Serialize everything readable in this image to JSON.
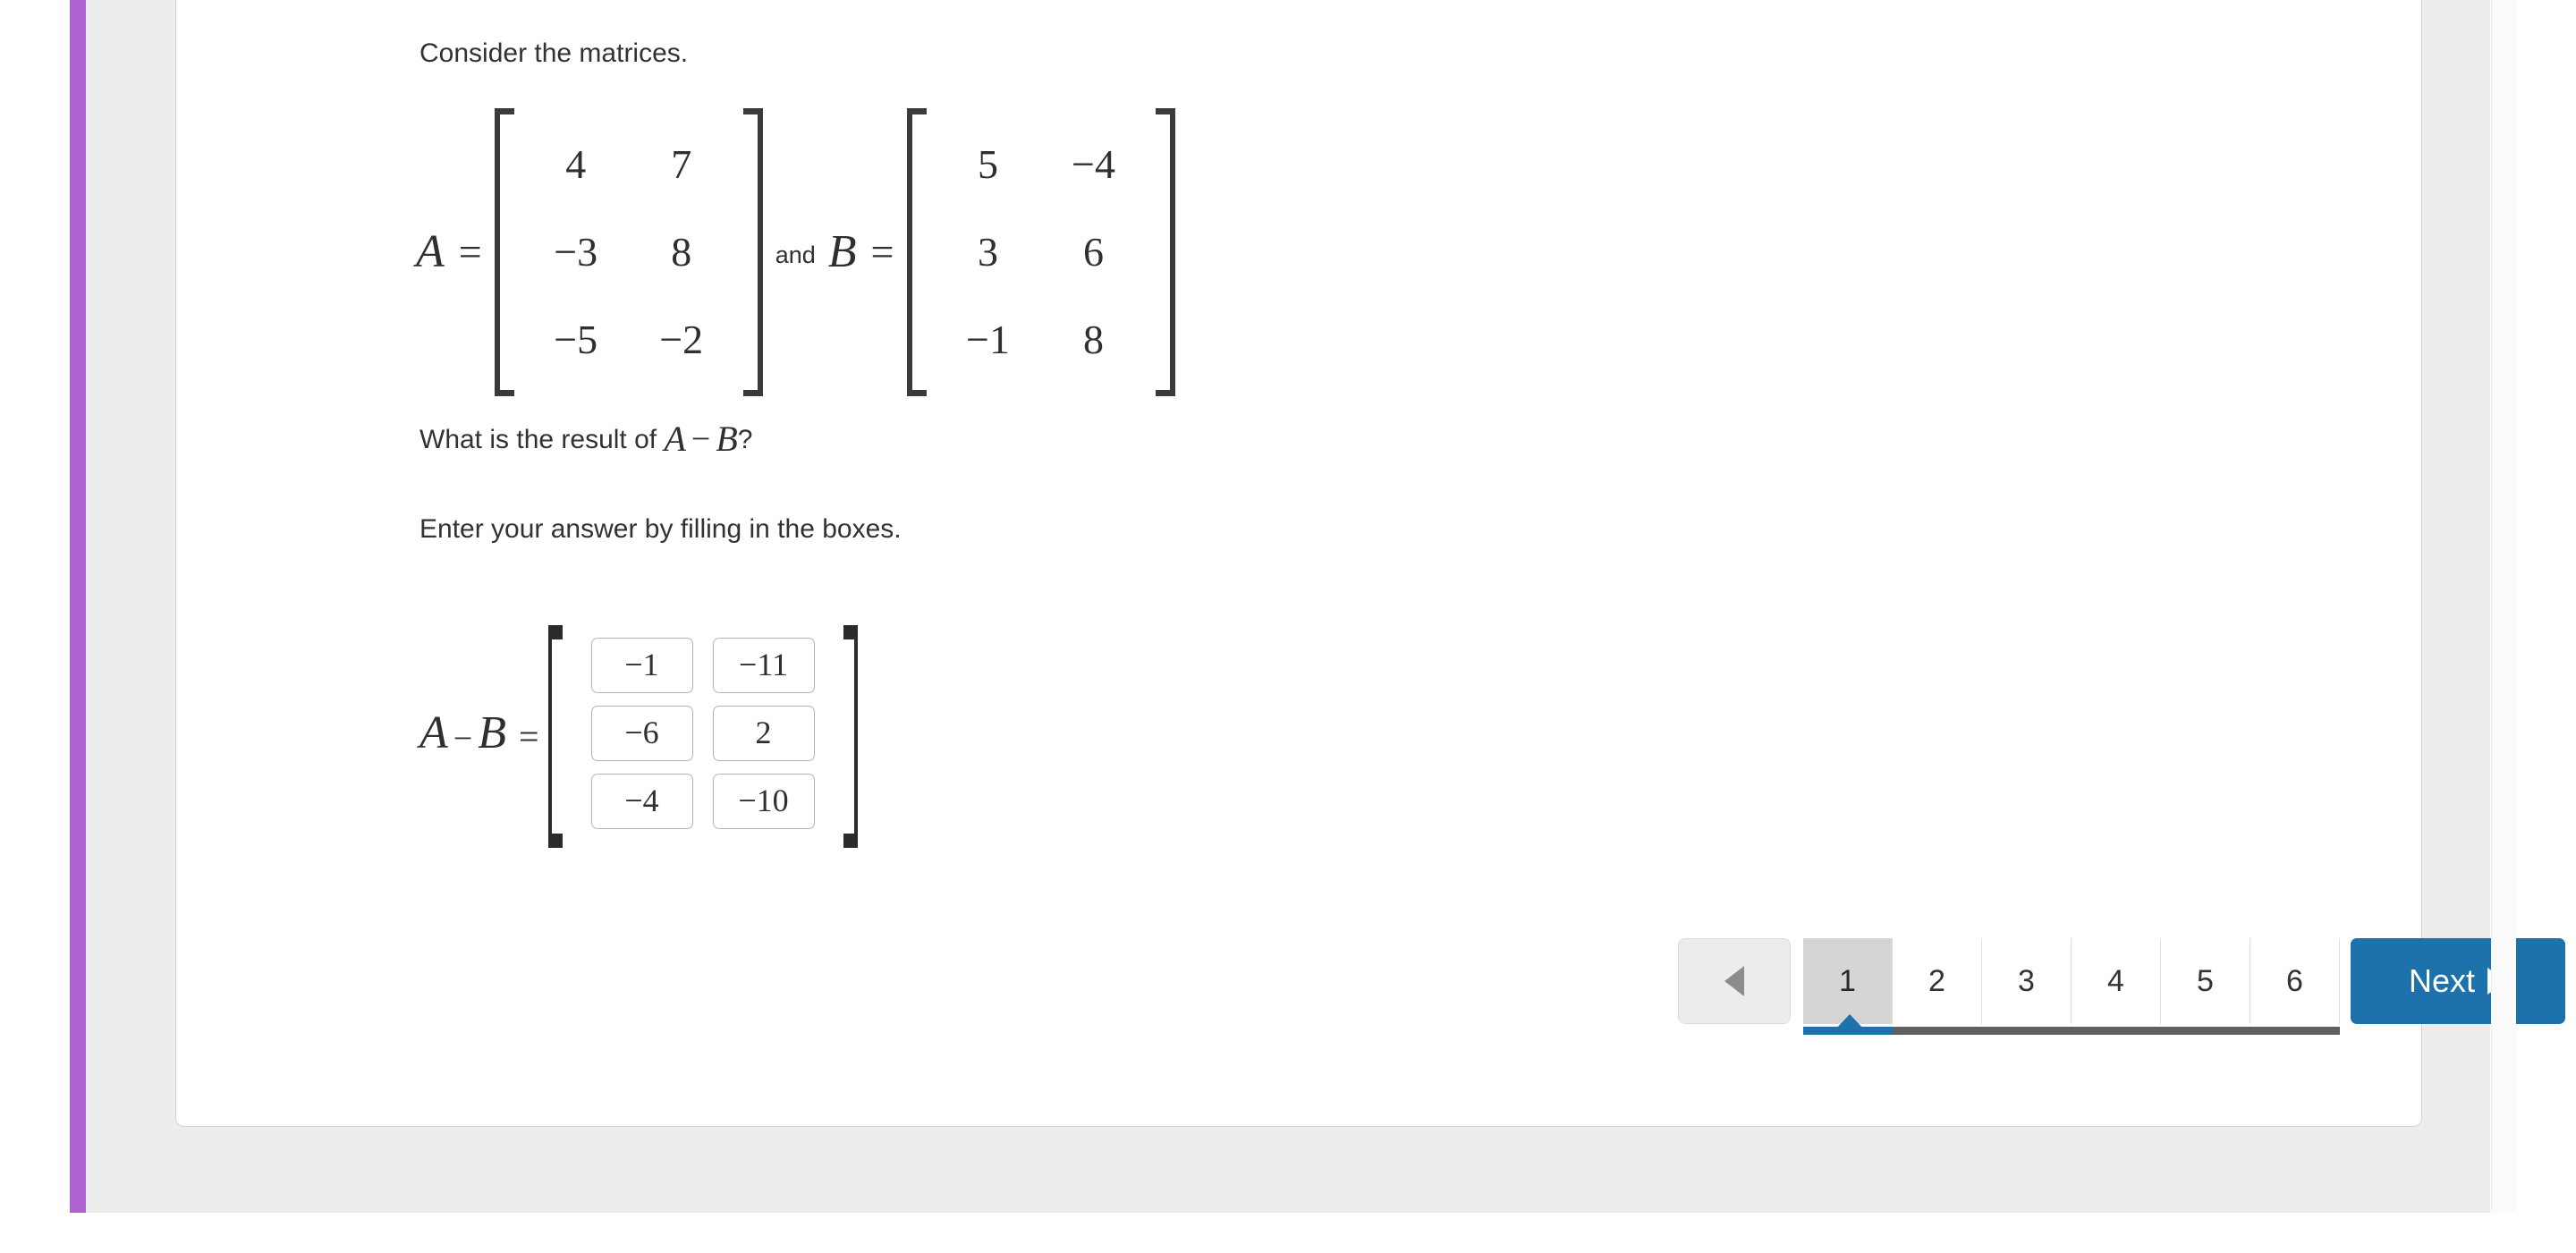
{
  "colors": {
    "rail_purple": "#b163d3",
    "app_background": "#ededed",
    "card_background": "#ffffff",
    "accent_blue": "#1d72ab",
    "active_tab_gray": "#d5d5d5",
    "progress_track_gray": "#606060",
    "text": "#323232"
  },
  "problem": {
    "intro": "Consider the matrices.",
    "question_prefix": "What is the result of ",
    "question_expr_a": "A",
    "question_expr_op": "−",
    "question_expr_b": "B",
    "question_suffix": "?",
    "instruction": "Enter your answer by filling in the boxes."
  },
  "matrix_a": {
    "label": "A",
    "equals": "=",
    "rows": [
      [
        "4",
        "7"
      ],
      [
        "−3",
        "8"
      ],
      [
        "−5",
        "−2"
      ]
    ]
  },
  "conjunction": "and",
  "matrix_b": {
    "label": "B",
    "equals": "=",
    "rows": [
      [
        "5",
        "−4"
      ],
      [
        "3",
        "6"
      ],
      [
        "−1",
        "8"
      ]
    ]
  },
  "answer": {
    "label_a": "A",
    "label_op": "−",
    "label_b": "B",
    "equals": "=",
    "boxes": [
      [
        "−1",
        "−11"
      ],
      [
        "−6",
        "2"
      ],
      [
        "−4",
        "−10"
      ]
    ]
  },
  "pagination": {
    "prev_icon": "triangle-left-icon",
    "pages": [
      "1",
      "2",
      "3",
      "4",
      "5",
      "6"
    ],
    "active_page": "1",
    "next_label": "Next",
    "next_icon": "triangle-right-icon"
  }
}
